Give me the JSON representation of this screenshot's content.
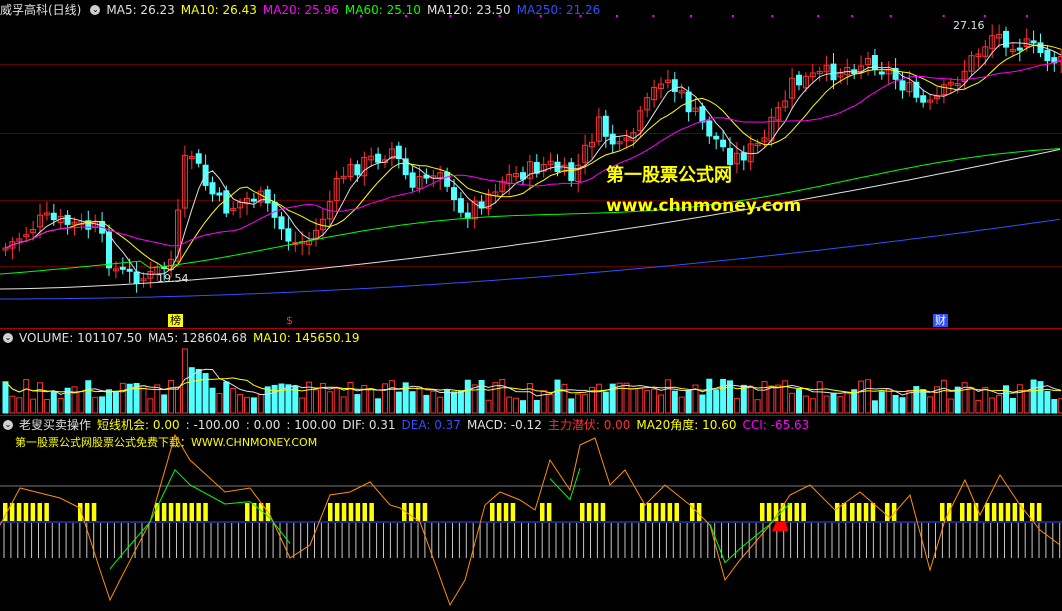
{
  "main_panel": {
    "title": "威孚高科(日线)",
    "indicators": [
      {
        "text": "MA5: 26.23",
        "color": "#e0e0e0"
      },
      {
        "text": "MA10: 26.43",
        "color": "#ffff00"
      },
      {
        "text": "MA20: 25.96",
        "color": "#ff00ff"
      },
      {
        "text": "MA60: 25.10",
        "color": "#00ff00"
      },
      {
        "text": "MA120: 23.50",
        "color": "#e0e0e0"
      },
      {
        "text": "MA250: 21.26",
        "color": "#3050ff"
      }
    ],
    "high_label": "27.16",
    "low_label": "19.54",
    "badges": {
      "bang": "榜",
      "s": "$",
      "cai": "财"
    }
  },
  "watermark": {
    "line1": "第一股票公式网",
    "line2": "www.chnmoney.com"
  },
  "volume_panel": {
    "items": [
      {
        "text": "VOLUME: 101107.50",
        "color": "#e0e0e0"
      },
      {
        "text": "MA5: 128604.68",
        "color": "#e0e0e0"
      },
      {
        "text": "MA10: 145650.19",
        "color": "#ffff00"
      }
    ]
  },
  "indicator_panel": {
    "items": [
      {
        "text": "老叟买卖操作",
        "color": "#e0e0e0"
      },
      {
        "text": "短线机会: 0.00",
        "color": "#ffff00"
      },
      {
        "text": ": -100.00",
        "color": "#e0e0e0"
      },
      {
        "text": ": 0.00",
        "color": "#e0e0e0"
      },
      {
        "text": ": 100.00",
        "color": "#e0e0e0"
      },
      {
        "text": "DIF: 0.31",
        "color": "#e0e0e0"
      },
      {
        "text": "DEA: 0.37",
        "color": "#3050ff"
      },
      {
        "text": "MACD: -0.12",
        "color": "#e0e0e0"
      },
      {
        "text": "主力潜伏: 0.00",
        "color": "#ff3030"
      },
      {
        "text": "MA20角度: 10.60",
        "color": "#ffff00"
      },
      {
        "text": "CCI: -65.63",
        "color": "#ff00ff"
      }
    ],
    "subtitle": "第一股票公式网股票公式免费下载：WWW.CHNMONEY.COM"
  },
  "colors": {
    "up": "#ff3232",
    "down": "#54ffff",
    "grid": "#8b0000",
    "ma5": "#e0e0e0",
    "ma10": "#ffff00",
    "ma20": "#ff00ff",
    "ma60": "#00ff00",
    "ma120": "#e0e0e0",
    "ma250": "#3050ff",
    "signal": "#ffff00"
  },
  "icons": {
    "panel_toggle": "circle-chevron-icon"
  }
}
